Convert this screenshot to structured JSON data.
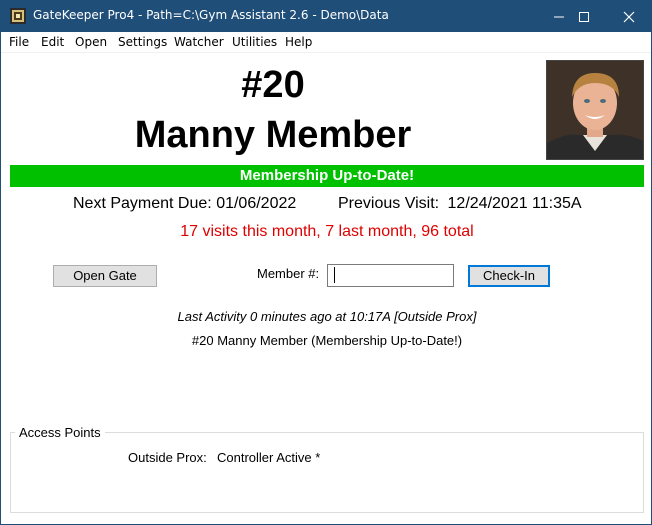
{
  "window": {
    "title": "GateKeeper Pro4 - Path=C:\\Gym Assistant 2.6 - Demo\\Data",
    "icons": {
      "app": "gatekeeper-app-icon",
      "minimize": "minimize-icon",
      "maximize": "maximize-icon",
      "close": "close-icon"
    },
    "titlebar_color": "#1f4e79"
  },
  "menu": [
    "File",
    "Edit",
    "Open",
    "Settings",
    "Watcher",
    "Utilities",
    "Help"
  ],
  "member": {
    "number": "#20",
    "name": "Manny Member",
    "photo": "member-photo"
  },
  "status": {
    "label": "Membership Up-to-Date!",
    "color": "#00c000"
  },
  "payment": {
    "next_label": "Next Payment Due:",
    "next_value": "01/06/2022",
    "prev_label": "Previous Visit:",
    "prev_value": "12/24/2021 11:35A"
  },
  "visits": {
    "summary": "17 visits this month, 7 last month, 96 total",
    "color": "#e00000"
  },
  "controls": {
    "open_gate": "Open Gate",
    "member_label": "Member #:",
    "member_value": "",
    "checkin": "Check-In"
  },
  "activity": {
    "last": "Last Activity 0 minutes ago at 10:17A [Outside Prox]",
    "member_line": "#20 Manny Member (Membership Up-to-Date!)"
  },
  "access_points": {
    "title": "Access Points",
    "items": [
      {
        "name": "Outside Prox:",
        "status": "Controller Active *"
      }
    ]
  }
}
